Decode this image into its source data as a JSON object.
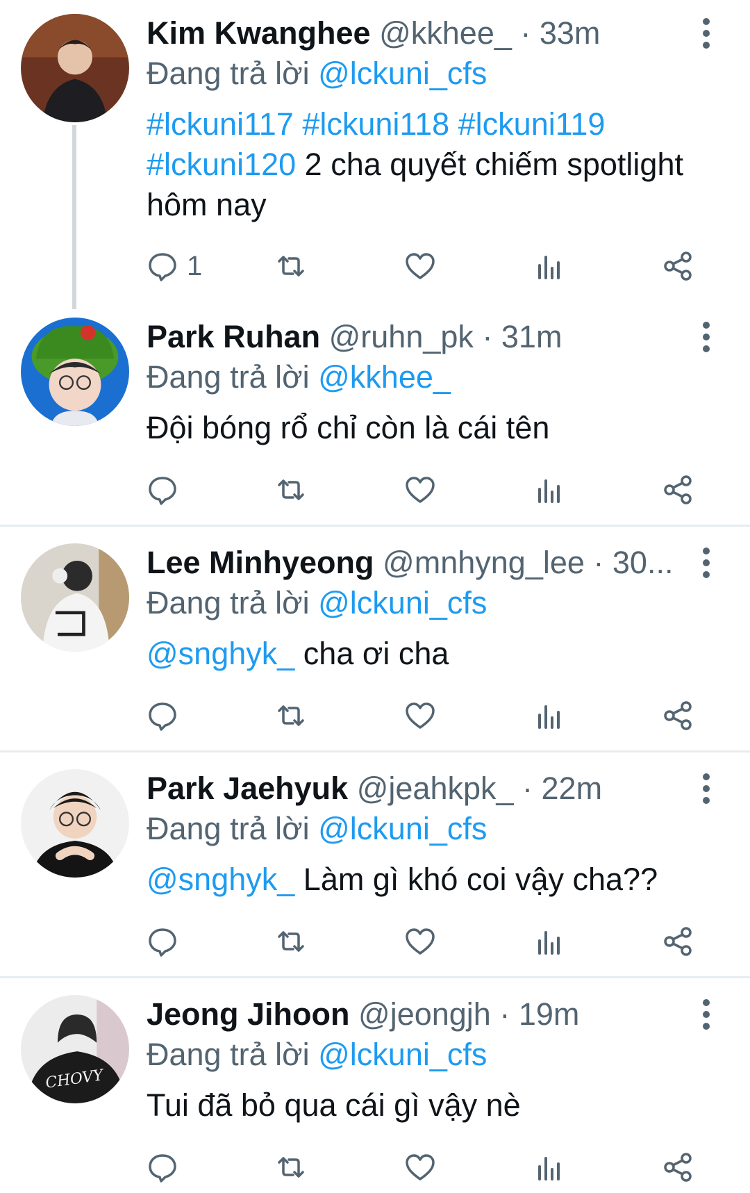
{
  "colors": {
    "accent": "#1d9bf0",
    "secondary_text": "#536471",
    "divider": "#e6ecf0"
  },
  "tweets": [
    {
      "name": "Kim Kwanghee",
      "meta": "@kkhee_ · 33m",
      "replying_prefix": "Đang trả lời",
      "replying_to": "@lckuni_cfs",
      "tags": "#lckuni117 #lckuni118 #lckuni119 #lckuni120",
      "text_after_tags": " 2 cha quyết chiếm spotlight hôm nay",
      "reply_count": "1"
    },
    {
      "name": "Park Ruhan",
      "meta": "@ruhn_pk · 31m",
      "replying_prefix": "Đang trả lời",
      "replying_to": "@kkhee_",
      "text": "Đội bóng rổ chỉ còn là cái tên"
    },
    {
      "name": "Lee Minhyeong",
      "meta": "@mnhyng_lee · 30...",
      "replying_prefix": "Đang trả lời",
      "replying_to": "@lckuni_cfs",
      "mention": "@snghyk_",
      "text": " cha ơi cha"
    },
    {
      "name": "Park Jaehyuk",
      "meta": "@jeahkpk_ · 22m",
      "replying_prefix": "Đang trả lời",
      "replying_to": "@lckuni_cfs",
      "mention": "@snghyk_",
      "text": " Làm gì khó coi vậy cha??"
    },
    {
      "name": "Jeong Jihoon",
      "meta": "@jeongjh · 19m",
      "replying_prefix": "Đang trả lời",
      "replying_to": "@lckuni_cfs",
      "text": "Tui đã bỏ qua cái gì vậy nè"
    }
  ],
  "icons": [
    "reply-icon",
    "retweet-icon",
    "like-icon",
    "analytics-icon",
    "share-icon",
    "more-icon"
  ]
}
